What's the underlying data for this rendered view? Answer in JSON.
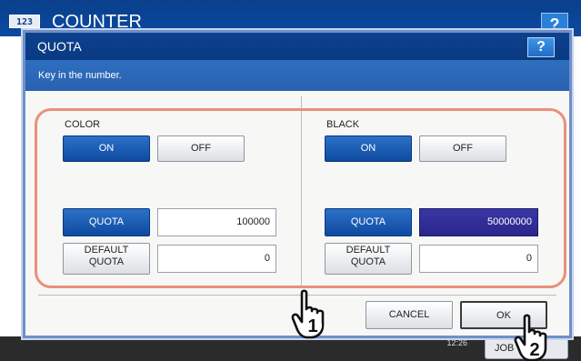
{
  "background": {
    "counter_icon": "123",
    "title": "COUNTER",
    "help_label": "?",
    "clock": "12:26",
    "job_button_label": "JOB"
  },
  "dialog": {
    "title": "QUOTA",
    "help_label": "?",
    "instruction": "Key in the number.",
    "color": {
      "label": "COLOR",
      "on_label": "ON",
      "off_label": "OFF",
      "quota_label": "QUOTA",
      "quota_value": "100000",
      "default_quota_label_1": "DEFAULT",
      "default_quota_label_2": "QUOTA",
      "default_quota_value": "0"
    },
    "black": {
      "label": "BLACK",
      "on_label": "ON",
      "off_label": "OFF",
      "quota_label": "QUOTA",
      "quota_value": "50000000",
      "default_quota_label_1": "DEFAULT",
      "default_quota_label_2": "QUOTA",
      "default_quota_value": "0"
    },
    "cancel_label": "CANCEL",
    "ok_label": "OK"
  },
  "callouts": {
    "step1": "1",
    "step2": "2"
  },
  "icons": {
    "hand1": "pointing-hand-icon",
    "hand2": "pointing-hand-icon"
  }
}
